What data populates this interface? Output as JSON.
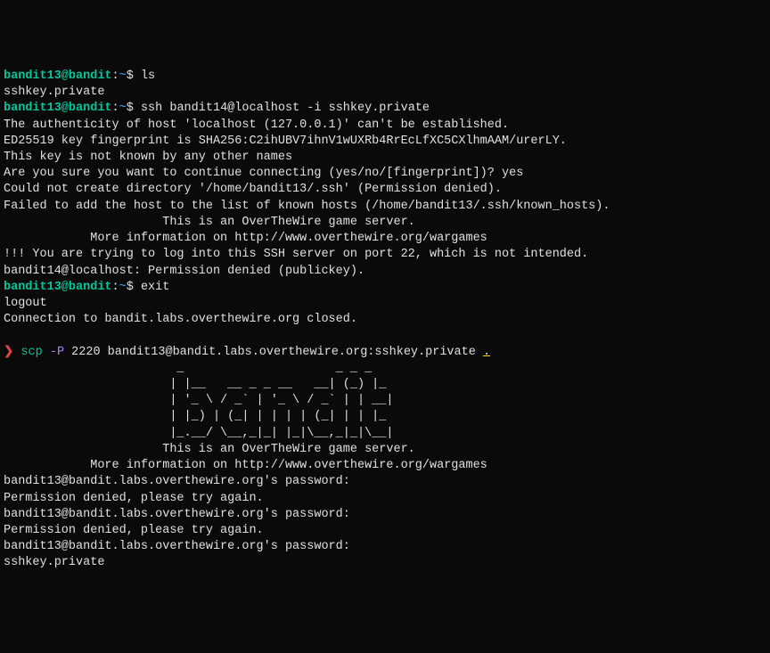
{
  "prompt1": {
    "user_host": "bandit13@bandit",
    "colon": ":",
    "tilde": "~",
    "dollar": "$ ",
    "cmd": "ls"
  },
  "out1": "sshkey.private",
  "prompt2": {
    "user_host": "bandit13@bandit",
    "colon": ":",
    "tilde": "~",
    "dollar": "$ ",
    "cmd": "ssh bandit14@localhost -i sshkey.private"
  },
  "ssh_out": {
    "l1": "The authenticity of host 'localhost (127.0.0.1)' can't be established.",
    "l2": "ED25519 key fingerprint is SHA256:C2ihUBV7ihnV1wUXRb4RrEcLfXC5CXlhmAAM/urerLY.",
    "l3": "This key is not known by any other names",
    "l4": "Are you sure you want to continue connecting (yes/no/[fingerprint])? yes",
    "l5": "Could not create directory '/home/bandit13/.ssh' (Permission denied).",
    "l6": "Failed to add the host to the list of known hosts (/home/bandit13/.ssh/known_hosts).",
    "blank1": "",
    "banner1_indent": "                      This is an OverTheWire game server.",
    "banner2_indent": "            More information on http://www.overthewire.org/wargames",
    "blank2": "",
    "warn": "!!! You are trying to log into this SSH server on port 22, which is not intended.",
    "blank3": "",
    "denied": "bandit14@localhost: Permission denied (publickey)."
  },
  "prompt3": {
    "user_host": "bandit13@bandit",
    "colon": ":",
    "tilde": "~",
    "dollar": "$ ",
    "cmd": "exit"
  },
  "exit_out": {
    "l1": "logout",
    "l2": "Connection to bandit.labs.overthewire.org closed."
  },
  "scp_prompt": {
    "arrow": "❯",
    "sp": " ",
    "cmd": "scp",
    "sp2": " ",
    "flag": "-P",
    "sp3": " ",
    "args": "2220 bandit13@bandit.labs.overthewire.org:sshkey.private ",
    "dot": "."
  },
  "ascii_art": {
    "l1": "                        _                     _ _ _",
    "l2": "                       | |__   __ _ _ __   __| (_) |_",
    "l3": "                       | '_ \\ / _` | '_ \\ / _` | | __|",
    "l4": "                       | |_) | (_| | | | | (_| | | |_",
    "l5": "                       |_.__/ \\__,_|_| |_|\\__,_|_|\\__|",
    "blank1": "",
    "blank2": "",
    "banner1": "                      This is an OverTheWire game server.",
    "banner2": "            More information on http://www.overthewire.org/wargames"
  },
  "scp_out": {
    "blank": "",
    "pw1": "bandit13@bandit.labs.overthewire.org's password:",
    "deny1": "Permission denied, please try again.",
    "pw2": "bandit13@bandit.labs.overthewire.org's password:",
    "deny2": "Permission denied, please try again.",
    "pw3": "bandit13@bandit.labs.overthewire.org's password:",
    "file": "sshkey.private"
  }
}
